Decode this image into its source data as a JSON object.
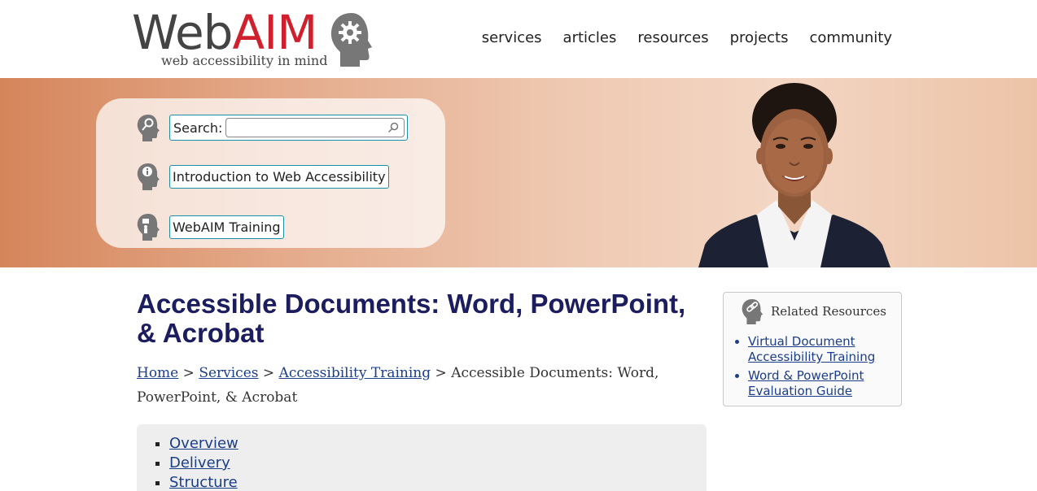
{
  "logo": {
    "word_web": "Web",
    "word_aim": "AIM",
    "tagline": "web accessibility in mind"
  },
  "nav": {
    "items": [
      "services",
      "articles",
      "resources",
      "projects",
      "community"
    ]
  },
  "banner": {
    "search_label": "Search:",
    "intro_link": "Introduction to Web Accessibility",
    "training_link": "WebAIM Training"
  },
  "page": {
    "title": "Accessible Documents: Word, PowerPoint, & Acrobat"
  },
  "breadcrumb": {
    "home": "Home",
    "sep": " > ",
    "services": "Services",
    "training": "Accessibility Training",
    "current": "Accessible Documents: Word, PowerPoint, & Acrobat"
  },
  "toc": {
    "items": [
      "Overview",
      "Delivery",
      "Structure"
    ]
  },
  "related": {
    "heading": "Related Resources",
    "items": [
      "Virtual Document Accessibility Training",
      "Word & PowerPoint Evaluation Guide"
    ]
  },
  "colors": {
    "brand_red": "#d0202e",
    "title_navy": "#1c1d5e",
    "link_blue": "#1c3e8a",
    "focus_teal": "#1a8fa8"
  }
}
